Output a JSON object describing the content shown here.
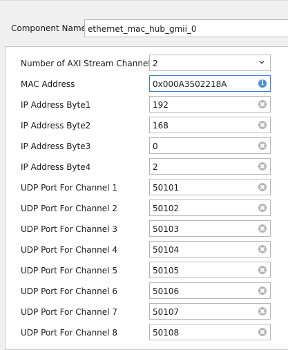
{
  "component": {
    "label": "Component Name",
    "value": "ethernet_mac_hub_gmii_0"
  },
  "fields": {
    "axi_channels": {
      "label": "Number of  AXI Stream Channels",
      "value": "2"
    },
    "mac_address": {
      "label": "MAC Address",
      "value": "0x000A3502218A",
      "icon": "info-icon"
    },
    "ip_byte1": {
      "label": "IP Address Byte1",
      "value": "192"
    },
    "ip_byte2": {
      "label": "IP Address Byte2",
      "value": "168"
    },
    "ip_byte3": {
      "label": "IP Address Byte3",
      "value": "0"
    },
    "ip_byte4": {
      "label": "IP Address Byte4",
      "value": "2"
    },
    "udp1": {
      "label": "UDP Port For Channel 1",
      "value": "50101"
    },
    "udp2": {
      "label": "UDP Port For Channel 2",
      "value": "50102"
    },
    "udp3": {
      "label": "UDP Port For Channel 3",
      "value": "50103"
    },
    "udp4": {
      "label": "UDP Port For Channel 4",
      "value": "50104"
    },
    "udp5": {
      "label": "UDP Port For Channel 5",
      "value": "50105"
    },
    "udp6": {
      "label": "UDP Port For Channel 6",
      "value": "50106"
    },
    "udp7": {
      "label": "UDP Port For Channel 7",
      "value": "50107"
    },
    "udp8": {
      "label": "UDP Port For Channel 8",
      "value": "50108"
    }
  },
  "colors": {
    "background": "#f0f0f0",
    "panel": "#ffffff",
    "focus_border": "#3c7fd6",
    "info_icon": "#4b8fe0",
    "clear_icon": "#b5b5b5"
  }
}
